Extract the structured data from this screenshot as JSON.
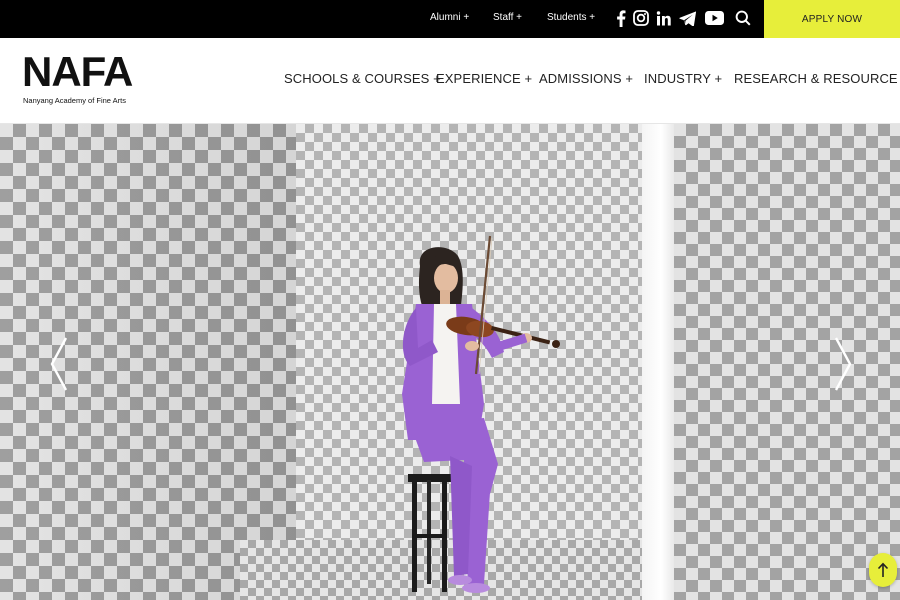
{
  "topbar": {
    "links": [
      {
        "label": "Alumni +"
      },
      {
        "label": "Staff +"
      },
      {
        "label": "Students +"
      }
    ],
    "social_icons": [
      "facebook-icon",
      "instagram-icon",
      "linkedin-icon",
      "telegram-icon",
      "youtube-icon"
    ],
    "apply_label": "APPLY NOW"
  },
  "header": {
    "logo_text": "NAFA",
    "logo_subtitle": "Nanyang Academy of Fine Arts",
    "nav": [
      {
        "label": "SCHOOLS & COURSES +"
      },
      {
        "label": "EXPERIENCE +"
      },
      {
        "label": "ADMISSIONS +"
      },
      {
        "label": "INDUSTRY +"
      },
      {
        "label": "RESEARCH & RESOURCE +"
      }
    ]
  },
  "hero": {
    "image": "violinist-in-checkered-room",
    "prev_icon": "chevron-left-icon",
    "next_icon": "chevron-right-icon"
  },
  "colors": {
    "accent": "#e7ee3a",
    "topbar_bg": "#000000",
    "suit_purple": "#9a62d3"
  }
}
